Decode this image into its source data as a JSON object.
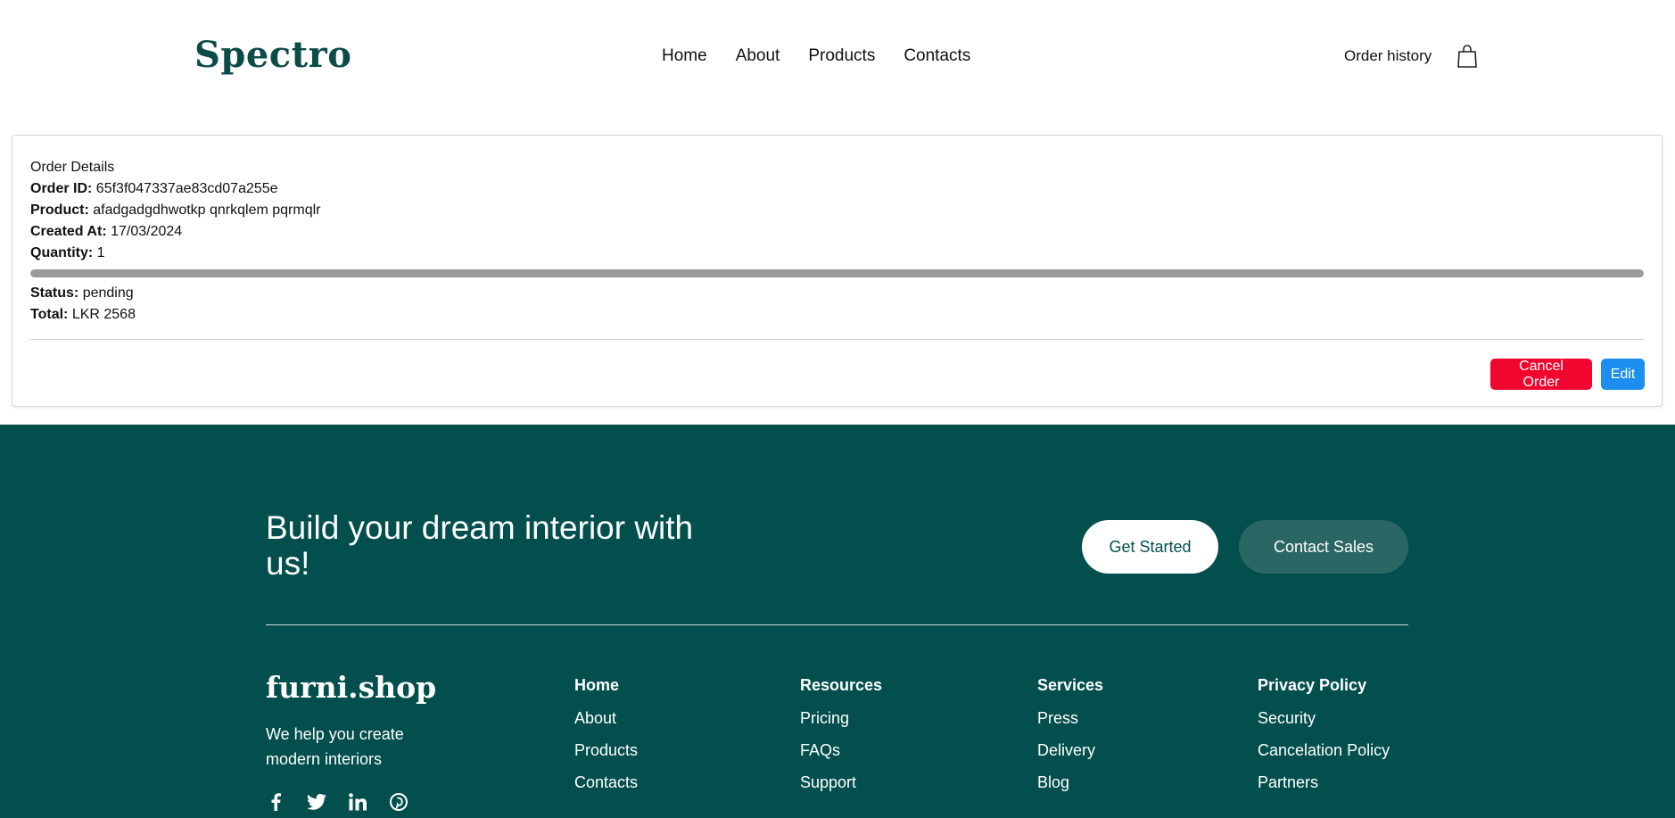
{
  "header": {
    "logo": "Spectro",
    "nav": [
      "Home",
      "About",
      "Products",
      "Contacts"
    ],
    "order_history": "Order history"
  },
  "order": {
    "section_title": "Order Details",
    "order_id_label": "Order ID:",
    "order_id": "65f3f047337ae83cd07a255e",
    "product_label": "Product:",
    "product": "afadgadgdhwotkp qnrkqlem pqrmqlr",
    "created_label": "Created At:",
    "created_at": "17/03/2024",
    "quantity_label": "Quantity:",
    "quantity": "1",
    "progress": 1.0,
    "status_label": "Status:",
    "status": "pending",
    "total_label": "Total:",
    "total": "LKR 2568",
    "cancel_label": "Cancel Order",
    "edit_label": "Edit"
  },
  "footer": {
    "cta": "Build your dream interior with us!",
    "get_started": "Get Started",
    "contact_sales": "Contact Sales",
    "brand": "furni.shop",
    "tagline": "We help you create modern interiors",
    "socials": [
      "facebook-icon",
      "twitter-icon",
      "linkedin-icon",
      "pinterest-icon"
    ],
    "columns": [
      {
        "heading": "Home",
        "links": [
          "About",
          "Products",
          "Contacts"
        ]
      },
      {
        "heading": "Resources",
        "links": [
          "Pricing",
          "FAQs",
          "Support"
        ]
      },
      {
        "heading": "Services",
        "links": [
          "Press",
          "Delivery",
          "Blog"
        ]
      },
      {
        "heading": "Privacy Policy",
        "links": [
          "Security",
          "Cancelation Policy",
          "Partners"
        ]
      }
    ]
  },
  "colors": {
    "brand": "#024f4d",
    "cancel": "#f0062f",
    "edit": "#1b8ef0"
  }
}
